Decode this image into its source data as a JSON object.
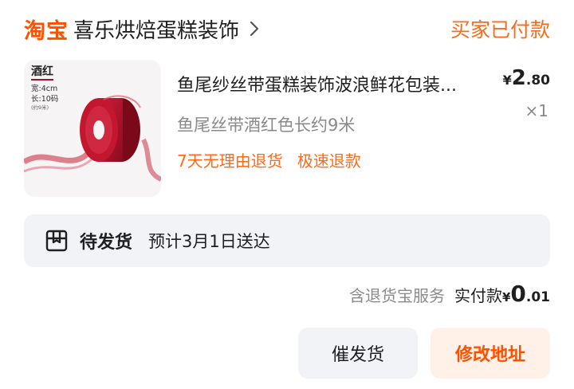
{
  "store": {
    "brand": "淘宝",
    "name": "喜乐烘焙蛋糕装饰",
    "chevron_icon": "chevron-right-icon"
  },
  "order": {
    "status": "买家已付款"
  },
  "product": {
    "thumbnail": {
      "title": "酒红",
      "spec_width": "宽:4cm",
      "spec_length": "长:10码",
      "spec_note": "(约9米)"
    },
    "title": "鱼尾纱丝带蛋糕装饰波浪鲜花包装...",
    "price": {
      "currency": "¥",
      "integer": "2",
      "decimal": ".80"
    },
    "quantity": "×1",
    "sku": "鱼尾丝带酒红色长约9米",
    "tags": [
      "7天无理由退货",
      "极速退款"
    ]
  },
  "shipping": {
    "icon": "package-icon",
    "status": "待发货",
    "eta": "预计3月1日送达"
  },
  "payment": {
    "service": "含退货宝服务",
    "label": "实付款",
    "currency": "¥",
    "integer": "0",
    "decimal": ".01"
  },
  "actions": {
    "urge": "催发货",
    "change_address": "修改地址"
  },
  "colors": {
    "accent": "#ff5000",
    "status": "#ff6a1a",
    "muted": "#8a8a8a",
    "panel": "#f1f3f7",
    "ribbon": "#b0132b"
  }
}
